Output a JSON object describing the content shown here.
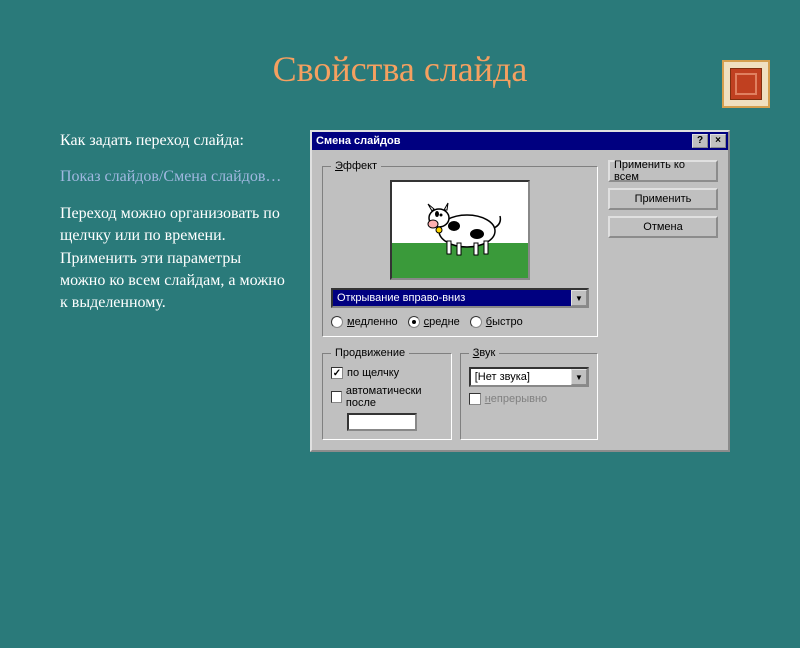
{
  "slide": {
    "title": "Свойства слайда",
    "text1": "Как задать переход слайда:",
    "menu_path": "Показ слайдов/Смена слайдов…",
    "text2": "Переход можно организовать по щелчку или по времени. Применить эти параметры можно ко всем слайдам, а можно к выделенному."
  },
  "dialog": {
    "title": "Смена слайдов",
    "help": "?",
    "close": "×",
    "effect": {
      "legend": "Эффект",
      "selected": "Открывание вправо-вниз",
      "speed": {
        "slow": "медленно",
        "medium": "средне",
        "fast": "быстро",
        "selected": "medium"
      }
    },
    "advance": {
      "legend": "Продвижение",
      "on_click": "по щелчку",
      "auto_after": "автоматически после"
    },
    "sound": {
      "legend": "Звук",
      "selected": "[Нет звука]",
      "loop": "непрерывно"
    },
    "buttons": {
      "apply_all": "Применить ко всем",
      "apply": "Применить",
      "cancel": "Отмена"
    }
  }
}
